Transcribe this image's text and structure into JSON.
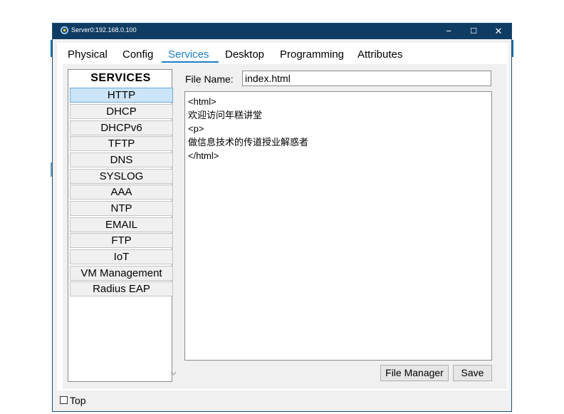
{
  "window": {
    "title": "Server0:192.168.0.100",
    "minimize": "−",
    "maximize": "☐",
    "close": "✕"
  },
  "tabs": [
    {
      "label": "Physical",
      "active": false
    },
    {
      "label": "Config",
      "active": false
    },
    {
      "label": "Services",
      "active": true
    },
    {
      "label": "Desktop",
      "active": false
    },
    {
      "label": "Programming",
      "active": false
    },
    {
      "label": "Attributes",
      "active": false
    }
  ],
  "services": {
    "header": "SERVICES",
    "items": [
      "HTTP",
      "DHCP",
      "DHCPv6",
      "TFTP",
      "DNS",
      "SYSLOG",
      "AAA",
      "NTP",
      "EMAIL",
      "FTP",
      "IoT",
      "VM Management",
      "Radius EAP"
    ],
    "selected": "HTTP"
  },
  "http": {
    "file_name_label": "File Name:",
    "file_name_value": "index.html",
    "content_lines": [
      "<html>",
      "欢迎访问年糕讲堂",
      "<p>",
      "做信息技术的传道授业解惑者",
      "</html>"
    ],
    "file_manager_label": "File Manager",
    "save_label": "Save"
  },
  "footer": {
    "top_label": "Top"
  },
  "colors": {
    "titlebar": "#0f3c63",
    "accent": "#1c7fc5",
    "selected_item": "#cce4f7"
  }
}
